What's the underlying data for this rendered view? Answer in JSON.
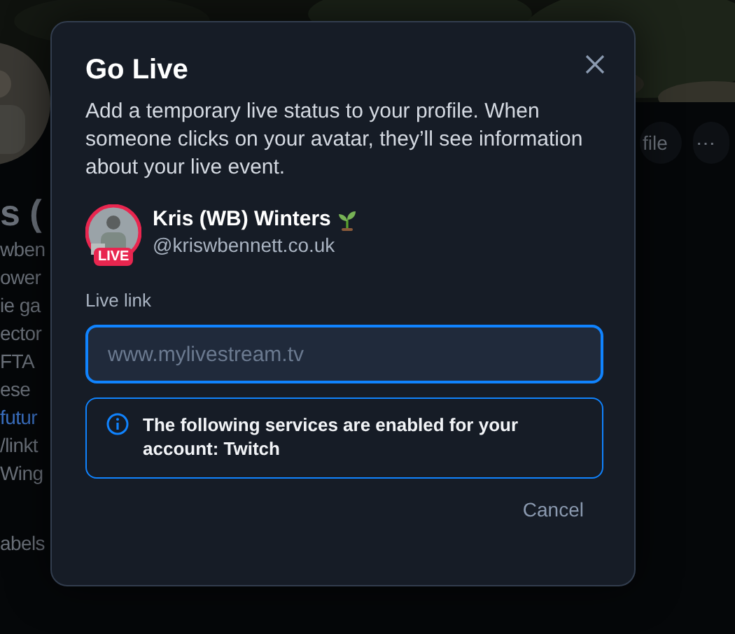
{
  "background": {
    "lines": [
      {
        "kind": "name",
        "text": "s ("
      },
      {
        "kind": "text",
        "text": "wben"
      },
      {
        "kind": "text",
        "text": "ower"
      },
      {
        "kind": "text",
        "text": "ie ga"
      },
      {
        "kind": "text",
        "text": "ector"
      },
      {
        "kind": "text",
        "text": "FTA"
      },
      {
        "kind": "text",
        "text": "ese"
      },
      {
        "kind": "link",
        "text": "futur"
      },
      {
        "kind": "text",
        "text": "/linkt"
      },
      {
        "kind": "text",
        "text": "Wing"
      },
      {
        "kind": "gap",
        "text": "abels"
      }
    ],
    "buttons": [
      "file",
      "⋯"
    ]
  },
  "dialog": {
    "title": "Go Live",
    "description": "Add a temporary live status to your profile. When someone clicks on your avatar, they’ll see information about your live event.",
    "profile": {
      "name": "Kris (WB) Winters",
      "handle": "@kriswbennett.co.uk",
      "badge": "LIVE"
    },
    "field": {
      "label": "Live link",
      "placeholder": "www.mylivestream.tv",
      "focused": true
    },
    "notice": "The following services are enabled for your account: Twitch",
    "cancel": "Cancel"
  }
}
